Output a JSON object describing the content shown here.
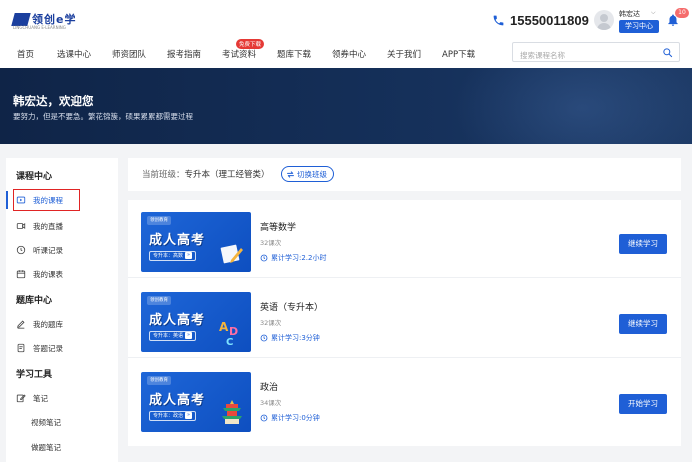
{
  "header": {
    "logo_text": "领创e学",
    "logo_sub": "LINGCHUANG E-LEARNING",
    "phone": "15550011809",
    "user_name": "韩宏达",
    "study_center": "学习中心",
    "notification_count": "10"
  },
  "nav": {
    "items": [
      "首页",
      "选课中心",
      "师资团队",
      "报考指南",
      "考试资料",
      "题库下载",
      "领券中心",
      "关于我们",
      "APP下载"
    ],
    "badge": "免费下载",
    "search_placeholder": "搜索课程名称"
  },
  "banner": {
    "welcome": "韩宏达，欢迎您",
    "motto": "要努力，但是不要急。繁花锦簇，硕果累累都需要过程"
  },
  "sidebar": {
    "course_center": "课程中心",
    "my_courses": "我的课程",
    "my_live": "我的直播",
    "listen_records": "听课记录",
    "my_schedule": "我的课表",
    "bank_center": "题库中心",
    "my_bank": "我的题库",
    "answer_records": "答题记录",
    "study_tools": "学习工具",
    "notes": "笔记",
    "video_notes": "视频笔记",
    "exercise_notes": "做题笔记"
  },
  "class_bar": {
    "label": "当前班级：",
    "value": "专升本（理工经管类）",
    "switch": "切换班级"
  },
  "thumb": {
    "brand": "领创教育",
    "title": "成人高考",
    "tag": "专升本 · 政治",
    "tag_tags": [
      "专升本：高数",
      "专升本：英语",
      "专升本：政治"
    ]
  },
  "courses": [
    {
      "name": "高等数学",
      "lessons": "32课次",
      "time": "累计学习:2.2小时",
      "button": "继续学习"
    },
    {
      "name": "英语（专升本）",
      "lessons": "32课次",
      "time": "累计学习:3分钟",
      "button": "继续学习"
    },
    {
      "name": "政治",
      "lessons": "34课次",
      "time": "累计学习:0分钟",
      "button": "开始学习"
    }
  ],
  "colors": {
    "accent": "#1f5fd6",
    "banner": "#15305a",
    "highlight": "#e02424"
  }
}
